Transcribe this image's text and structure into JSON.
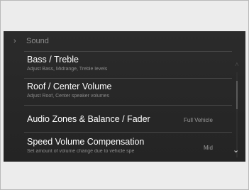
{
  "breadcrumb": {
    "label": "Sound"
  },
  "items": [
    {
      "title": "Bass / Treble",
      "subtitle": "Adjust Bass, Midrange, Treble levels"
    },
    {
      "title": "Roof / Center  Volume",
      "subtitle": "Adjust Roof, Center  speaker volumes"
    },
    {
      "title": "Audio Zones & Balance / Fader",
      "value": "Full Vehicle"
    },
    {
      "title": "Speed Volume Compensation",
      "subtitle": "Set amount of volume change due to vehicle spe",
      "value": "Mid"
    }
  ],
  "colors": {
    "screen_bg": "#262626",
    "text": "#ffffff",
    "subtext": "#8c8c8c"
  }
}
